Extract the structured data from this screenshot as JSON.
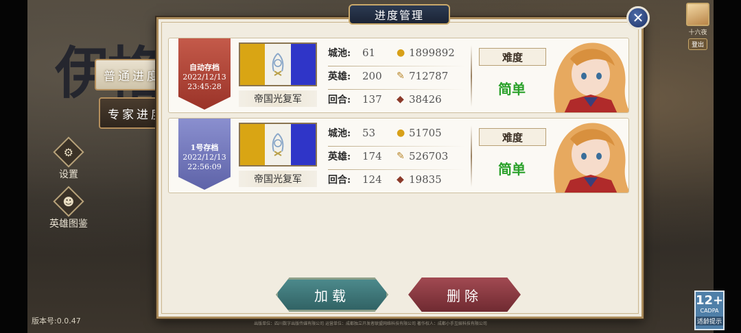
{
  "background": {
    "logo_text": "伊格",
    "modes": {
      "normal": "普通进度",
      "expert": "专家进度"
    },
    "side_menu": [
      {
        "label": "设置",
        "icon": "gear-icon"
      },
      {
        "label": "英雄图鉴",
        "icon": "portrait-icon"
      }
    ],
    "version": "版本号:0.0.47",
    "user": {
      "name": "十六夜",
      "logout": "登出"
    },
    "age_rating": {
      "number": "12+",
      "org": "CADPA",
      "tip": "适龄提示"
    },
    "footer": "出版单位：四川数字出版传媒有限公司 运营单位：成都独立开发者联盟网络科技有限公司 著作权人：成都小手互娱科技有限公司"
  },
  "dialog": {
    "title": "进度管理",
    "close_icon": "close-icon",
    "saves": [
      {
        "slot_name": "自动存档",
        "date": "2022/12/13",
        "time": "23:45:28",
        "ribbon_color": "#b0463a",
        "faction": "帝国光复军",
        "cities_label": "城池:",
        "cities": "61",
        "gold": "1899892",
        "heroes_label": "英雄:",
        "heroes": "200",
        "food": "712787",
        "turns_label": "回合:",
        "turns": "137",
        "cards": "38426",
        "difficulty_label": "难度",
        "difficulty": "简单"
      },
      {
        "slot_name": "1号存档",
        "date": "2022/12/13",
        "time": "22:56:09",
        "ribbon_color": "#7479bd",
        "faction": "帝国光复军",
        "cities_label": "城池:",
        "cities": "53",
        "gold": "51705",
        "heroes_label": "英雄:",
        "heroes": "174",
        "food": "526703",
        "turns_label": "回合:",
        "turns": "124",
        "cards": "19835",
        "difficulty_label": "难度",
        "difficulty": "简单"
      }
    ],
    "buttons": {
      "load": "加载",
      "delete": "删除"
    }
  },
  "colors": {
    "difficulty_easy": "#2aa12a",
    "title_plate": "#1b2435",
    "load_button": "#3e7678",
    "delete_button": "#8a3940"
  }
}
